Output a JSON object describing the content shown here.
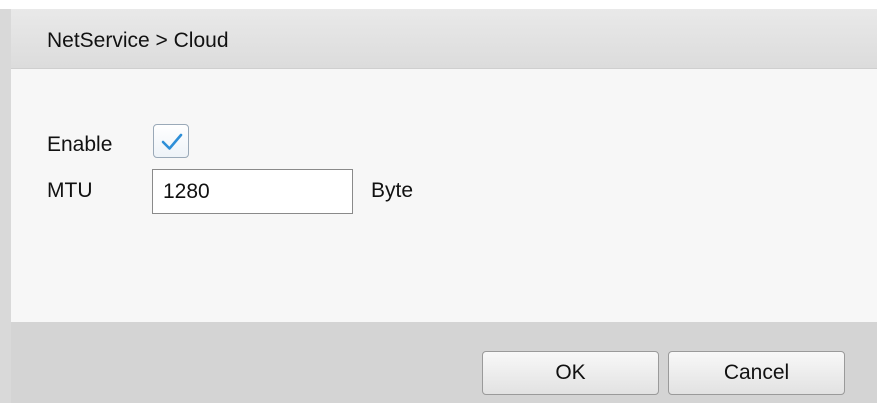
{
  "dialog": {
    "title": "NetService > Cloud"
  },
  "form": {
    "enable_label": "Enable",
    "enable_checked": true,
    "mtu_label": "MTU",
    "mtu_value": "1280",
    "mtu_unit": "Byte"
  },
  "footer": {
    "ok_label": "OK",
    "cancel_label": "Cancel"
  },
  "colors": {
    "checkmark": "#2e8fd8",
    "title_bar": "#e2e2e2",
    "body": "#f7f7f7",
    "footer": "#d4d4d4"
  },
  "icons": {
    "checkbox_check": "check-icon"
  }
}
